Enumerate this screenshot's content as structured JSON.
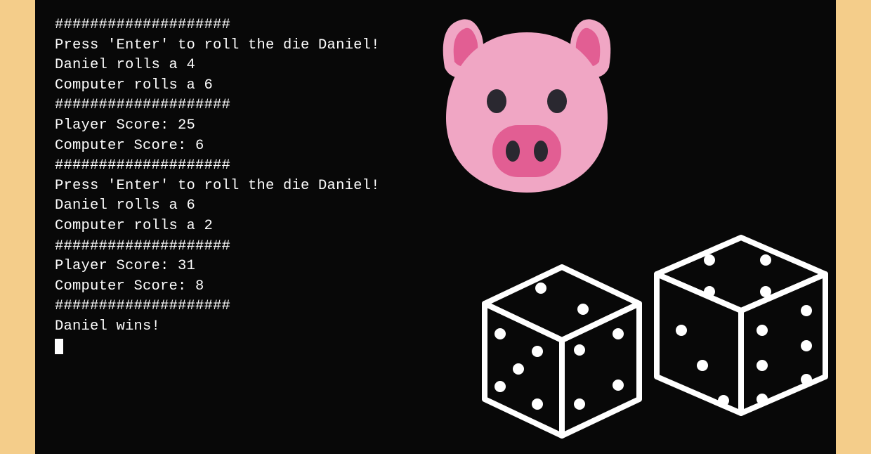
{
  "terminal": {
    "lines": [
      "####################",
      "",
      "Press 'Enter' to roll the die Daniel!",
      "",
      "Daniel rolls a 4",
      "Computer rolls a 6",
      "",
      "####################",
      "Player Score: 25",
      "Computer Score: 6",
      "####################",
      "",
      "Press 'Enter' to roll the die Daniel!",
      "",
      "Daniel rolls a 6",
      "Computer rolls a 2",
      "",
      "####################",
      "Player Score: 31",
      "Computer Score: 8",
      "####################",
      "",
      "Daniel wins!"
    ]
  },
  "graphics": {
    "pig_name": "pig-face-icon",
    "dice_name": "dice-icon"
  },
  "colors": {
    "background": "#f4cd8a",
    "terminal_bg": "#080808",
    "terminal_fg": "#fefefe",
    "pig_light": "#f0a6c4",
    "pig_dark": "#e25e93",
    "pig_eye": "#2a2830"
  }
}
